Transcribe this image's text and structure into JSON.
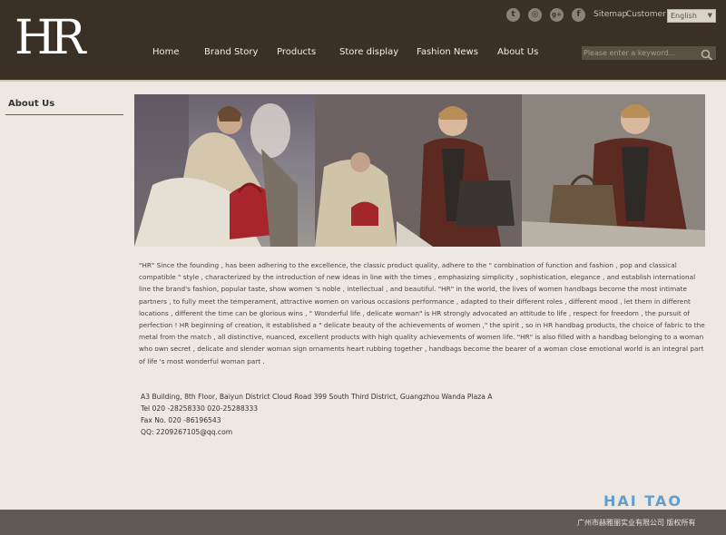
{
  "brand": {
    "logo_text": "HR"
  },
  "header": {
    "social": [
      {
        "icon": "twitter-icon",
        "glyph": "t"
      },
      {
        "icon": "instagram-icon",
        "glyph": "◎"
      },
      {
        "icon": "google-plus-icon",
        "glyph": "g+"
      },
      {
        "icon": "facebook-icon",
        "glyph": "f"
      }
    ],
    "sitemap_label": "Sitemap",
    "customer_label": "Customer",
    "language_selected": "English"
  },
  "nav": {
    "items": [
      "Home",
      "Brand Story",
      "Products",
      "Store display",
      "Fashion News",
      "About Us"
    ]
  },
  "search": {
    "placeholder": "Please enter a keyword..."
  },
  "sidebar": {
    "title": "About Us"
  },
  "about": {
    "paragraph": "\"HR\" Since the founding , has been adhering to the excellence, the classic product quality, adhere to the \" combination of function and fashion , pop and classical compatible \" style , characterized by the introduction of new ideas in line with the times , emphasizing simplicity , sophistication, elegance , and establish international line the brand's fashion, popular taste, show women 's noble , intellectual , and beautiful. \"HR\" in the world, the lives of women handbags become the most intimate partners , to fully meet the temperament, attractive women on various occasions performance , adapted to their different roles , different mood , let them in different locations , different the time can be glorious wins , \" Wonderful life , delicate woman\" is HR strongly advocated an attitude to life , respect for freedom , the pursuit of perfection ! HR beginning of creation, it established a \" delicate beauty of the achievements of women ,\" the spirit , so in HR handbag products, the choice of fabric to the metal from the match , all distinctive, nuanced, excellent products with high quality achievements of women life. \"HR\" is also filled with a handbag belonging to a woman who own secret , delicate and slender woman sign ornaments heart rubbing together , handbags become the bearer of a woman close emotional world is an integral part of life 's most wonderful woman part ."
  },
  "contact": {
    "address": "A3 Building, 8th Floor, Baiyun District Cloud Road 399 South Third District, Guangzhou Wanda Plaza A",
    "tel": "Tel 020 -28258330 020-25288333",
    "fax": "Fax No. 020 -86196543",
    "qq": "QQ: 2209267105@qq.com"
  },
  "footer": {
    "copyright": "广州市赫雅丽实业有限公司 版权所有",
    "watermark": "HAI TAO"
  },
  "colors": {
    "header_bg": "#3a3025",
    "page_bg": "#ede9e2",
    "footer_bg": "#5f5a54"
  }
}
